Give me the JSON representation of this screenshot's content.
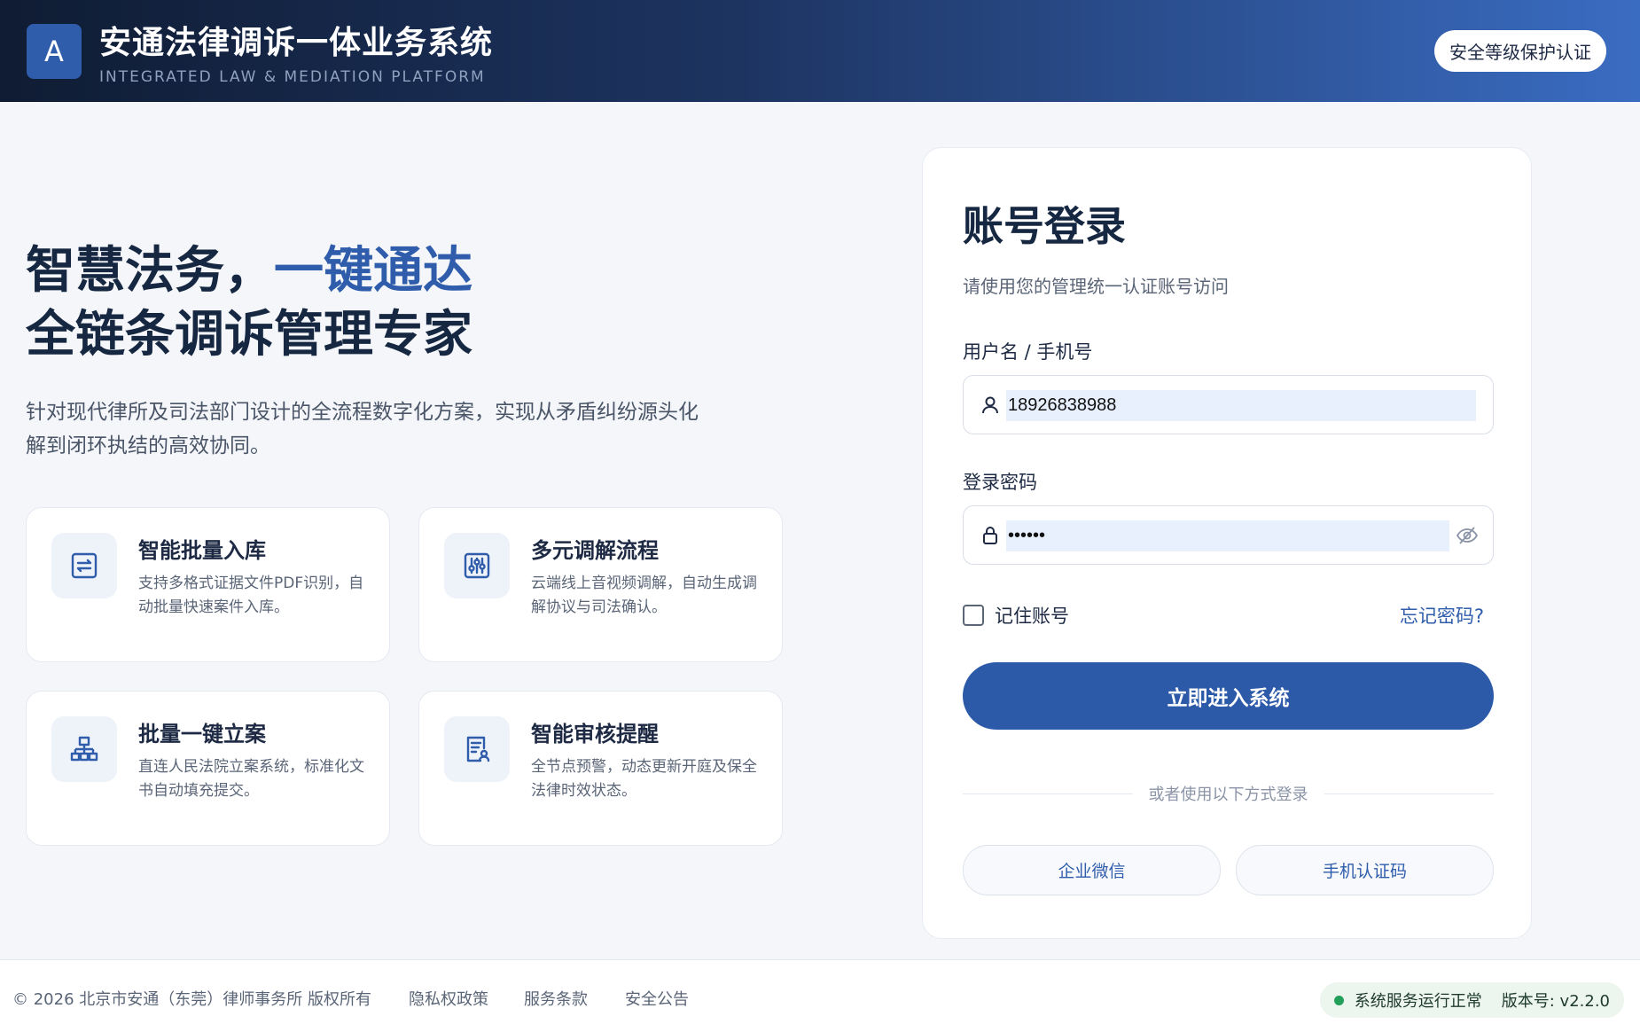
{
  "header": {
    "logo_letter": "A",
    "title": "安通法律调诉一体业务系统",
    "subtitle": "INTEGRATED LAW & MEDIATION PLATFORM",
    "badge": "安全等级保护认证"
  },
  "hero": {
    "line1_prefix": "智慧法务，",
    "line1_accent": "一键通达",
    "line2": "全链条调诉管理专家",
    "description": "针对现代律所及司法部门设计的全流程数字化方案，实现从矛盾纠纷源头化解到闭环执结的高效协同。"
  },
  "features": [
    {
      "title": "智能批量入库",
      "desc": "支持多格式证据文件PDF识别，自动批量快速案件入库。",
      "icon": "sync-icon"
    },
    {
      "title": "多元调解流程",
      "desc": "云端线上音视频调解，自动生成调解协议与司法确认。",
      "icon": "sliders-icon"
    },
    {
      "title": "批量一键立案",
      "desc": "直连人民法院立案系统，标准化文书自动填充提交。",
      "icon": "org-chart-icon"
    },
    {
      "title": "智能审核提醒",
      "desc": "全节点预警，动态更新开庭及保全法律时效状态。",
      "icon": "document-user-icon"
    }
  ],
  "login": {
    "title": "账号登录",
    "subtitle": "请使用您的管理统一认证账号访问",
    "username_label": "用户名 / 手机号",
    "username_value": "18926838988",
    "password_label": "登录密码",
    "password_value": "••••••",
    "remember_label": "记住账号",
    "remember_checked": false,
    "forgot_label": "忘记密码?",
    "submit_label": "立即进入系统",
    "divider_text": "或者使用以下方式登录",
    "alt_wechat": "企业微信",
    "alt_sms": "手机认证码"
  },
  "footer": {
    "copyright": "© 2026 北京市安通（东莞）律师事务所 版权所有",
    "links": [
      "隐私权政策",
      "服务条款",
      "安全公告"
    ],
    "status": "系统服务运行正常",
    "version": "版本号: v2.2.0"
  },
  "colors": {
    "accent": "#2f5dab",
    "header_dark": "#0f1c33",
    "status_green": "#22a05a"
  }
}
